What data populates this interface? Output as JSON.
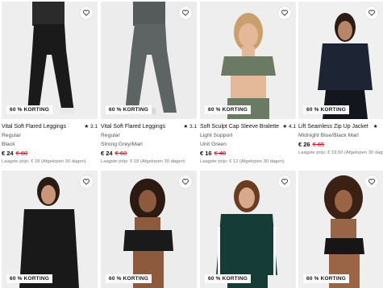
{
  "badge_text": "60 % KORTING",
  "products": [
    {
      "title": "Vital Soft Flared Leggings",
      "rating": "★ 3.1",
      "fit": "Regular",
      "color": "Black",
      "price": "€ 24",
      "old_price": "€ 60",
      "lowest": "Laagste prijs: € 18 (Afgelopen 30 dagen)"
    },
    {
      "title": "Vital Soft Flared Leggings",
      "rating": "★ 3.1",
      "fit": "Regular",
      "color": "Strong Grey/Marl",
      "price": "€ 24",
      "old_price": "€ 60",
      "lowest": "Laagste prijs: € 18 (Afgelopen 30 dagen)"
    },
    {
      "title": "Soft Sculpt Cap Sleeve Bralette",
      "rating": "★ 4.1",
      "fit": "Light Support",
      "color": "Unit Green",
      "price": "€ 16",
      "old_price": "€ 40",
      "lowest": "Laagste prijs: € 12 (Afgelopen 30 dagen)"
    },
    {
      "title": "Lift Seamless Zip Up Jacket",
      "rating": "★",
      "fit": "Midnight Blue/Black Marl",
      "color": "",
      "price": "€ 26",
      "old_price": "€ 65",
      "lowest": "Laagste prijs: € 19,50 (Afgelopen 30 dagen)"
    }
  ],
  "icons": {
    "favorite": "heart-icon"
  }
}
